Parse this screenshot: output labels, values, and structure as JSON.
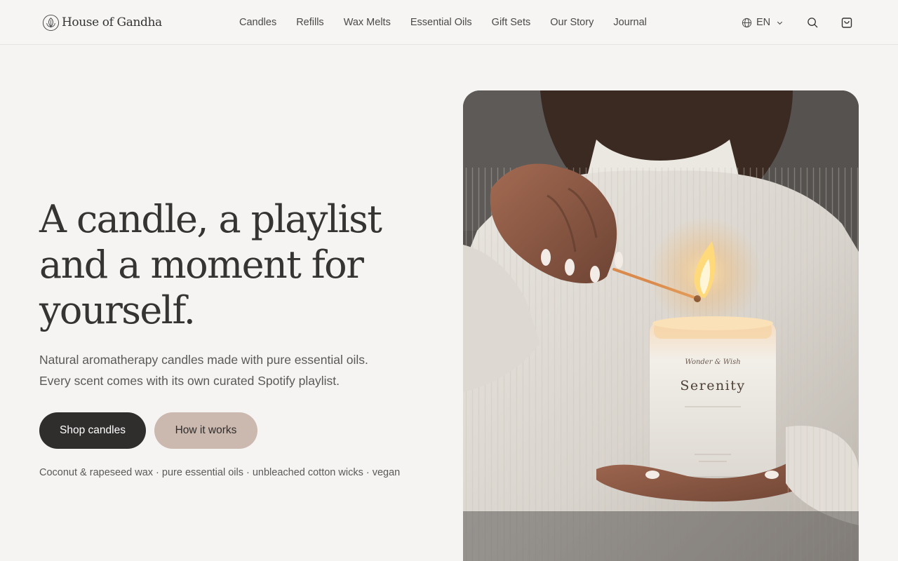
{
  "brand": {
    "name": "House of Gandha",
    "logo_icon": "leaf-circle-icon"
  },
  "nav": {
    "items": [
      {
        "label": "Candles"
      },
      {
        "label": "Refills"
      },
      {
        "label": "Wax Melts"
      },
      {
        "label": "Essential Oils"
      },
      {
        "label": "Gift Sets"
      },
      {
        "label": "Our Story"
      },
      {
        "label": "Journal"
      }
    ]
  },
  "header": {
    "language": "EN",
    "language_icon": "globe-icon",
    "search_icon": "search-icon",
    "cart_icon": "shopping-bag-icon"
  },
  "hero": {
    "title_lines": [
      "A candle, a playlist",
      "and a moment for",
      "yourself."
    ],
    "subtitle_lines": [
      "Natural aromatherapy candles made with pure essential oils.",
      "Every scent comes with its own curated Spotify playlist."
    ],
    "primary_cta": "Shop candles",
    "secondary_cta": "How it works",
    "features": "Coconut & rapeseed wax · pure essential oils · unbleached cotton wicks · vegan"
  },
  "image": {
    "jar_brand": "Wonder & Wish",
    "jar_label": "Serenity"
  },
  "colors": {
    "primary_button": "#2f2e2d",
    "secondary_button": "#cbb8ae",
    "background": "#f5f4f3"
  }
}
